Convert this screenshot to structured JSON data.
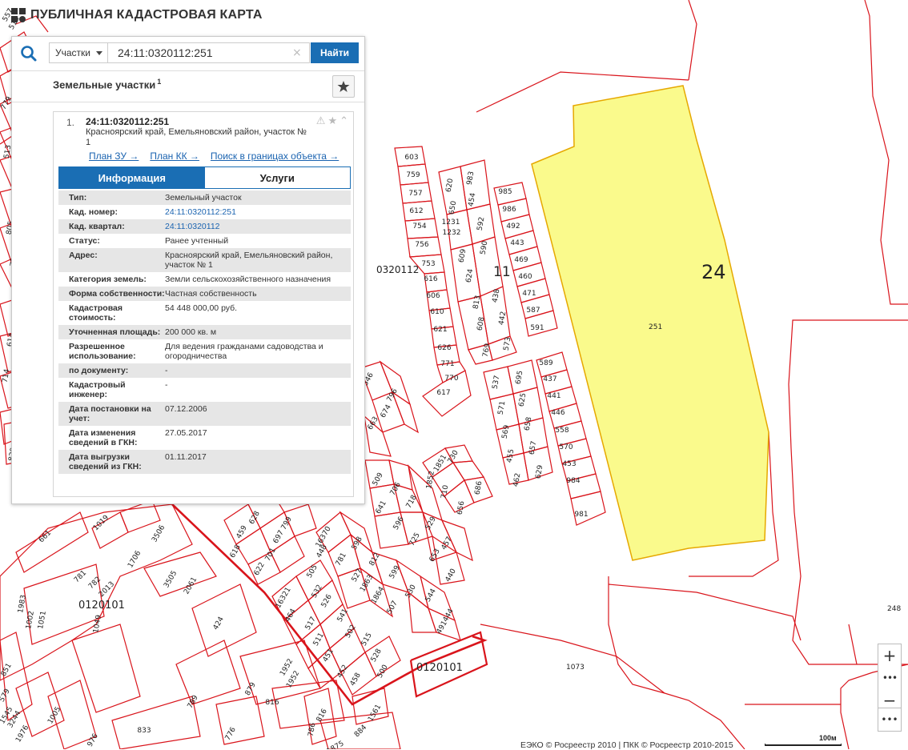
{
  "app": {
    "title": "ПУБЛИЧНАЯ КАДАСТРОВАЯ КАРТА"
  },
  "search": {
    "type_label": "Участки",
    "query": "24:11:0320112:251",
    "find_label": "Найти"
  },
  "results": {
    "title": "Земельные участки",
    "count": "1"
  },
  "item": {
    "number": "1.",
    "id": "24:11:0320112:251",
    "address": "Красноярский край, Емельяновский район, участок № 1",
    "links": [
      "План ЗУ →",
      "План КК →",
      "Поиск в границах объекта →"
    ],
    "tabs": [
      "Информация",
      "Услуги"
    ],
    "info": [
      {
        "k": "Тип:",
        "v": "Земельный участок",
        "link": false
      },
      {
        "k": "Кад. номер:",
        "v": "24:11:0320112:251",
        "link": true
      },
      {
        "k": "Кад. квартал:",
        "v": "24:11:0320112",
        "link": true
      },
      {
        "k": "Статус:",
        "v": "Ранее учтенный",
        "link": false
      },
      {
        "k": "Адрес:",
        "v": "Красноярский край, Емельяновский район, участок № 1",
        "link": false
      },
      {
        "k": "Категория земель:",
        "v": "Земли сельскохозяйственного назначения",
        "link": false
      },
      {
        "k": "Форма собственности:",
        "v": "Частная собственность",
        "link": false
      },
      {
        "k": "Кадастровая стоимость:",
        "v": "54 448 000,00 руб.",
        "link": false
      },
      {
        "k": "Уточненная площадь:",
        "v": "200 000 кв. м",
        "link": false
      },
      {
        "k": "Разрешенное использование:",
        "v": "Для ведения гражданами садоводства и огородничества",
        "link": false
      },
      {
        "k": "по документу:",
        "v": "-",
        "link": false
      },
      {
        "k": "Кадастровый инженер:",
        "v": "-",
        "link": false
      },
      {
        "k": "Дата постановки на учет:",
        "v": "07.12.2006",
        "link": false
      },
      {
        "k": "Дата изменения сведений в ГКН:",
        "v": "27.05.2017",
        "link": false
      },
      {
        "k": "Дата выгрузки сведений из ГКН:",
        "v": "01.11.2017",
        "link": false
      }
    ]
  },
  "map": {
    "colors": {
      "boundary": "#d9141b",
      "highlight_fill": "#fafa8c",
      "highlight_stroke": "#e6a800",
      "background": "#ffffff",
      "accent": "#1a6eb4"
    },
    "labels": {
      "quarter_main": "0320112",
      "quarter_code": "11",
      "district_code": "24",
      "selected_plot": "251",
      "quarter_2": "0120101",
      "quarter_3": "0120101",
      "plot_248": "248",
      "plot_1073": "1073"
    },
    "plot_labels": [
      "603",
      "759",
      "757",
      "612",
      "754",
      "756",
      "753",
      "616",
      "606",
      "610",
      "621",
      "626",
      "771",
      "770",
      "617",
      "620",
      "983",
      "650",
      "454",
      "1231",
      "1232",
      "592",
      "590",
      "609",
      "624",
      "438",
      "813",
      "442",
      "608",
      "573",
      "769",
      "985",
      "986",
      "492",
      "443",
      "469",
      "460",
      "471",
      "587",
      "591",
      "589",
      "437",
      "441",
      "446",
      "558",
      "570",
      "453",
      "984",
      "981",
      "537",
      "695",
      "571",
      "625",
      "569",
      "658",
      "455",
      "657",
      "462",
      "629",
      "509",
      "706",
      "718",
      "641",
      "596",
      "529",
      "725",
      "457",
      "653",
      "440",
      "448",
      "598",
      "812",
      "599",
      "530",
      "544",
      "444",
      "491",
      "16370",
      "781",
      "527",
      "1863",
      "1864",
      "507",
      "505",
      "532",
      "526",
      "541",
      "502",
      "515",
      "528",
      "500",
      "16321",
      "464",
      "517",
      "511",
      "451",
      "452",
      "458",
      "459",
      "697",
      "618",
      "701",
      "622",
      "628",
      "799",
      "661",
      "1019",
      "1706",
      "3506",
      "3505",
      "2061",
      "781",
      "782",
      "2013",
      "1983",
      "1002",
      "1051",
      "1049",
      "424",
      "789",
      "1005",
      "3244",
      "976",
      "833",
      "776",
      "879",
      "1952",
      "816",
      "1952",
      "816",
      "786",
      "1561",
      "884",
      "1875",
      "851",
      "579",
      "1545",
      "1976",
      "839",
      "543",
      "685",
      "714",
      "614",
      "619",
      "636",
      "782",
      "805",
      "737",
      "728",
      "749",
      "779",
      "550",
      "461",
      "510",
      "513",
      "551",
      "518",
      "557",
      "546",
      "796",
      "674",
      "663",
      "730",
      "1851",
      "1852",
      "710",
      "686",
      "656",
      "766"
    ]
  },
  "controls": {
    "zoom_in": "+",
    "zoom_out": "−",
    "more": "•••",
    "zoom_more": "•••"
  },
  "footer": {
    "copyright": "ЕЭКО © Росреестр 2010 | ПКК © Росреестр 2010-2015",
    "scale_label": "100м"
  }
}
